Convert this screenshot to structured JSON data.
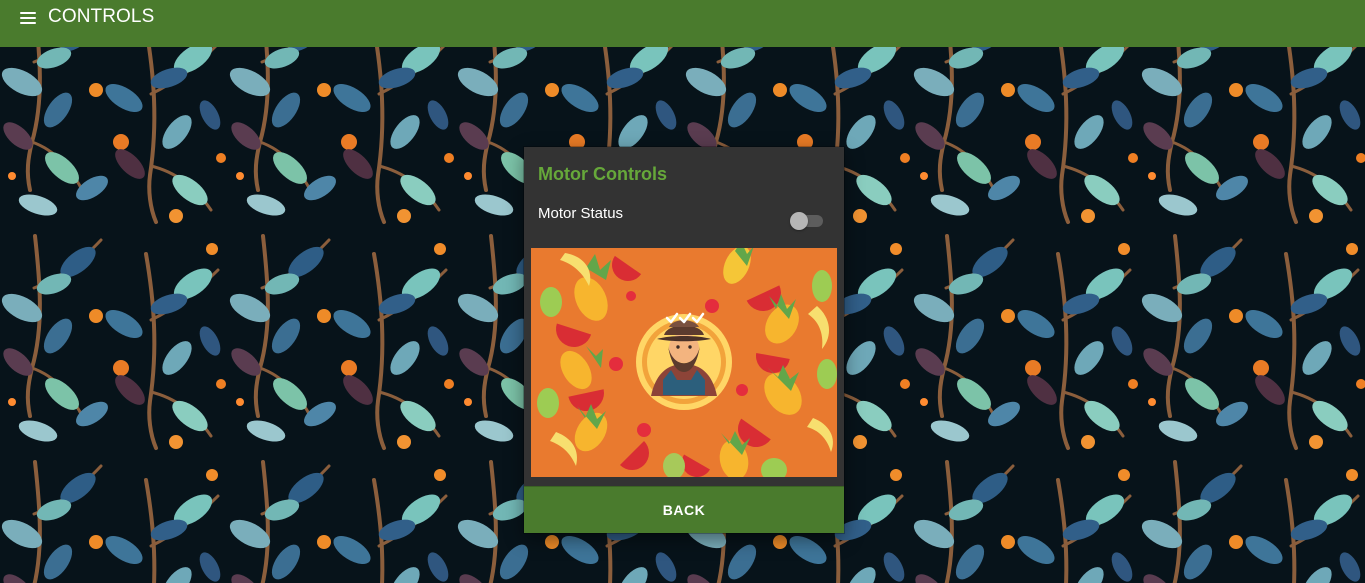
{
  "appbar": {
    "title": "CONTROLS",
    "menu_icon": "hamburger-menu-icon"
  },
  "motor_card": {
    "title": "Motor Controls",
    "status_label": "Motor Status",
    "motor_on": false,
    "image_subject": "farmer-with-fruits",
    "back_label": "BACK"
  },
  "colors": {
    "appbar": "#4a7b2d",
    "card": "#333333",
    "title_accent": "#66a83a",
    "background": "#07131a",
    "illustration": "#e97a2f"
  }
}
